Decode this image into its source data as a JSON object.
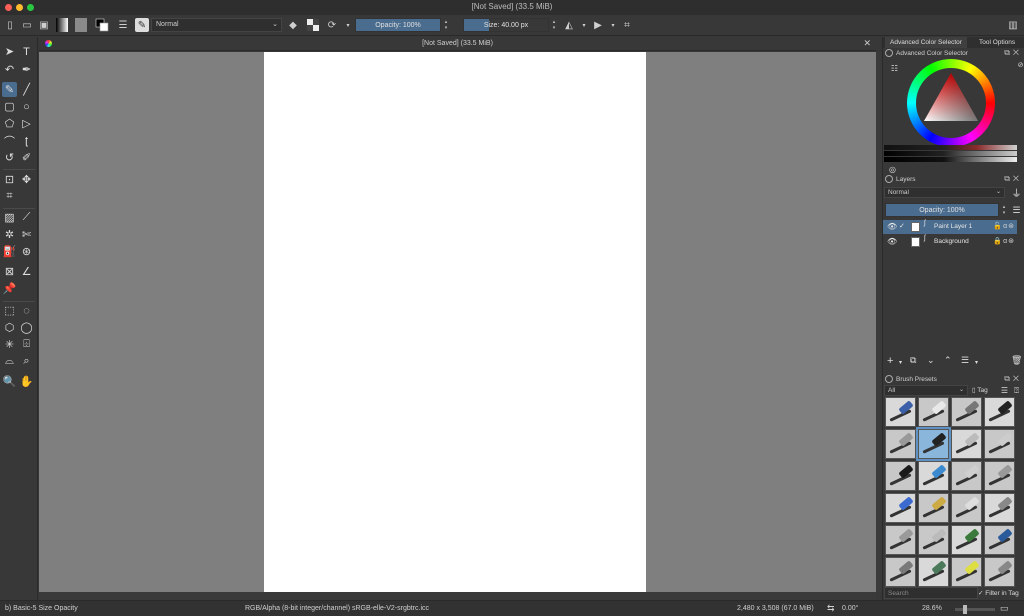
{
  "window": {
    "title": "[Not Saved]  (33.5 MiB)",
    "traffic_colors": [
      "#fe5f57",
      "#febc2e",
      "#28c840"
    ]
  },
  "toolbar": {
    "blend_mode": "Normal",
    "opacity_label": "Opacity: 100%",
    "opacity_value": 1.0,
    "size_label": "Size: 40.00 px",
    "size_value": 0.3
  },
  "document": {
    "tab_title": "[Not Saved]  (33.5 MiB)"
  },
  "dockers": {
    "color": {
      "tabs": [
        "Advanced Color Selector",
        "Tool Options"
      ],
      "title": "Advanced Color Selector"
    },
    "layers": {
      "title": "Layers",
      "blend_mode": "Normal",
      "opacity_label": "Opacity:  100%",
      "items": [
        {
          "name": "Paint Layer 1",
          "selected": true
        },
        {
          "name": "Background",
          "selected": false
        }
      ]
    },
    "presets": {
      "title": "Brush Presets",
      "filter": "All",
      "tag_label": "Tag",
      "search_placeholder": "Search",
      "filter_in_tag_label": "Filter in Tag"
    }
  },
  "status": {
    "brush": "b) Basic-5 Size Opacity",
    "color_space": "RGB/Alpha (8-bit integer/channel)  sRGB-elle-V2-srgbtrc.icc",
    "dimensions": "2,480 x 3,508 (67.0 MiB)",
    "rotation": "0.00°",
    "zoom": "28.6%"
  },
  "colors": {
    "accent": "#4a6c8e",
    "panel": "#383838",
    "canvas_bg": "#7f7f7f",
    "paper": "#ffffff"
  }
}
